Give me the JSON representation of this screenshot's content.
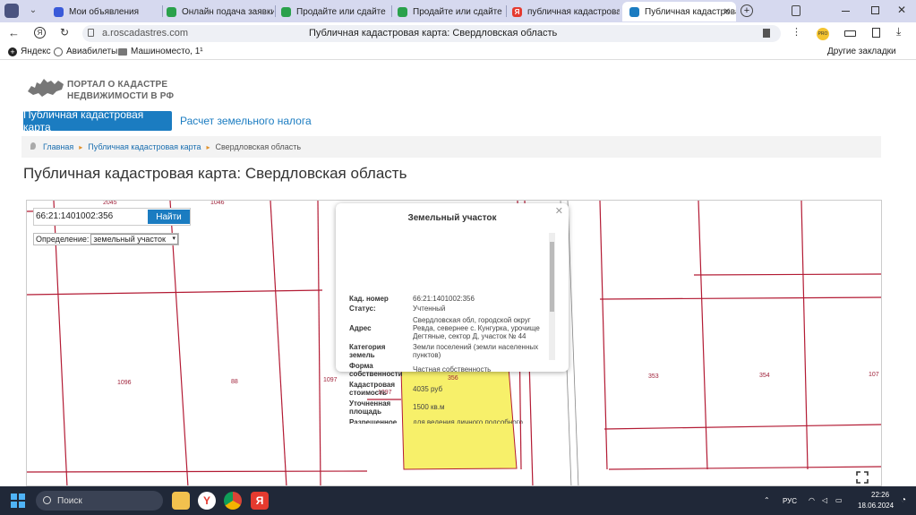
{
  "browser": {
    "tabs": [
      {
        "title": "",
        "favicon_color": "#4a5380"
      },
      {
        "title": "Мои объявления",
        "favicon_color": "#3a5ad9"
      },
      {
        "title": "Онлайн подача заявки н",
        "favicon_color": "#2aa14b"
      },
      {
        "title": "Продайте или сдайте в",
        "favicon_color": "#2aa14b"
      },
      {
        "title": "Продайте или сдайте в",
        "favicon_color": "#2aa14b"
      },
      {
        "title": "публичная кадастрова",
        "favicon_color": "#e53a2f"
      },
      {
        "title": "Публичная кадастрова",
        "favicon_color": "#1b7cc1"
      }
    ],
    "url": "a.roscadastres.com",
    "page_title_center": "Публичная кадастровая карта: Свердловская область",
    "bookmarks": [
      "Яндекс",
      "Авиабилеты",
      "Машиноместо, 1¹"
    ],
    "other_bookmarks": "Другие закладки"
  },
  "site": {
    "logo_line1": "ПОРТАЛ О КАДАСТРЕ",
    "logo_line2": "НЕДВИЖИМОСТИ В РФ",
    "nav_active": "Публичная кадастровая карта",
    "nav_link": "Расчет земельного налога",
    "breadcrumbs": [
      "Главная",
      "Публичная кадастровая карта",
      "Свердловская область"
    ],
    "heading": "Публичная кадастровая карта: Свердловская область"
  },
  "map": {
    "search_value": "66:21:1401002:356",
    "find_label": "Найти",
    "definition_label": "Определение:",
    "definition_value": "земельный участок",
    "parcel_labels": [
      "2045",
      "1046",
      "1096",
      "88",
      "1097",
      "1097",
      "356",
      "353",
      "354",
      "107"
    ],
    "highlight_color": "#f7f06a",
    "line_color": "#b31b34"
  },
  "popup": {
    "title": "Земельный участок",
    "rows": [
      {
        "label": "Кад. номер",
        "value": "66:21:1401002:356"
      },
      {
        "label": "Статус:",
        "value": "Учтенный"
      },
      {
        "label": "Адрес",
        "value": "Свердловская обл, городской округ Ревда, севернее с. Кунгурка, урочище Дегтяные, сектор Д, участок № 44"
      },
      {
        "label": "Категория земель",
        "value": "Земли поселений (земли населенных пунктов)"
      },
      {
        "label": "Форма собственности",
        "value": "Частная собственность"
      },
      {
        "label": "Кадастровая стоимость",
        "value": "4035 руб"
      },
      {
        "label": "Уточненная площадь",
        "value": "1500 кв.м"
      },
      {
        "label": "Разрешенное",
        "value": "для ведения личного подсобного"
      }
    ]
  },
  "taskbar": {
    "search_label": "Поиск",
    "lang": "РУС",
    "time": "22:26",
    "date": "18.06.2024"
  }
}
